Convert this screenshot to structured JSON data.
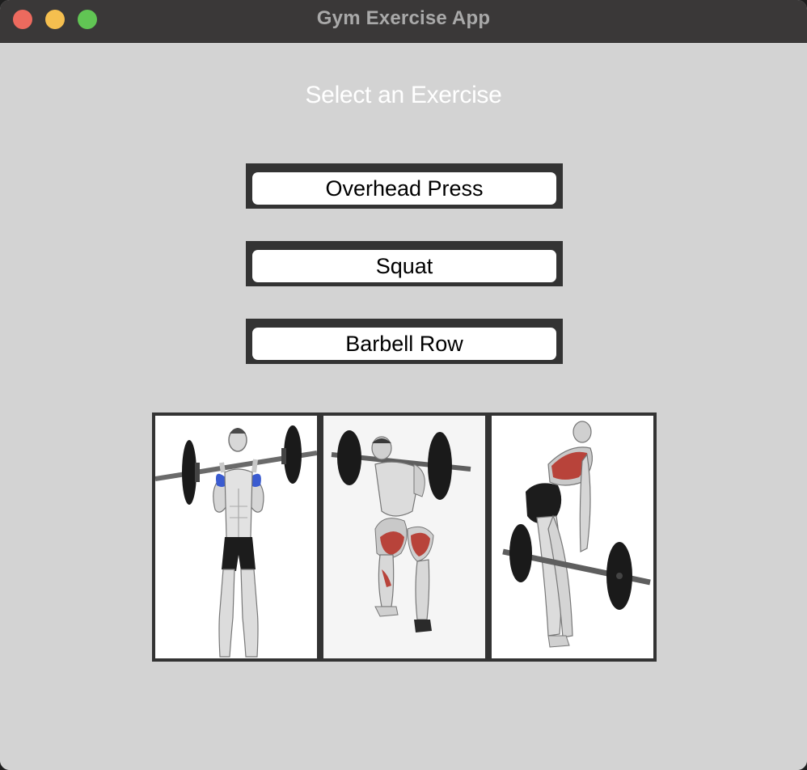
{
  "window": {
    "title": "Gym Exercise App"
  },
  "main": {
    "heading": "Select an Exercise",
    "buttons": [
      {
        "label": "Overhead Press"
      },
      {
        "label": "Squat"
      },
      {
        "label": "Barbell Row"
      }
    ]
  },
  "gallery": {
    "images": [
      {
        "icon": "overhead-press-illustration",
        "highlight_color": "#3a5bd0"
      },
      {
        "icon": "squat-illustration",
        "highlight_color": "#b8433a"
      },
      {
        "icon": "barbell-row-illustration",
        "highlight_color": "#b8433a"
      }
    ]
  },
  "colors": {
    "titlebar": "#3a3838",
    "background": "#d3d3d3",
    "button_frame": "#333333",
    "button_face": "#ffffff",
    "close": "#ed6a5e",
    "minimize": "#f5bf4f",
    "maximize": "#61c554"
  }
}
